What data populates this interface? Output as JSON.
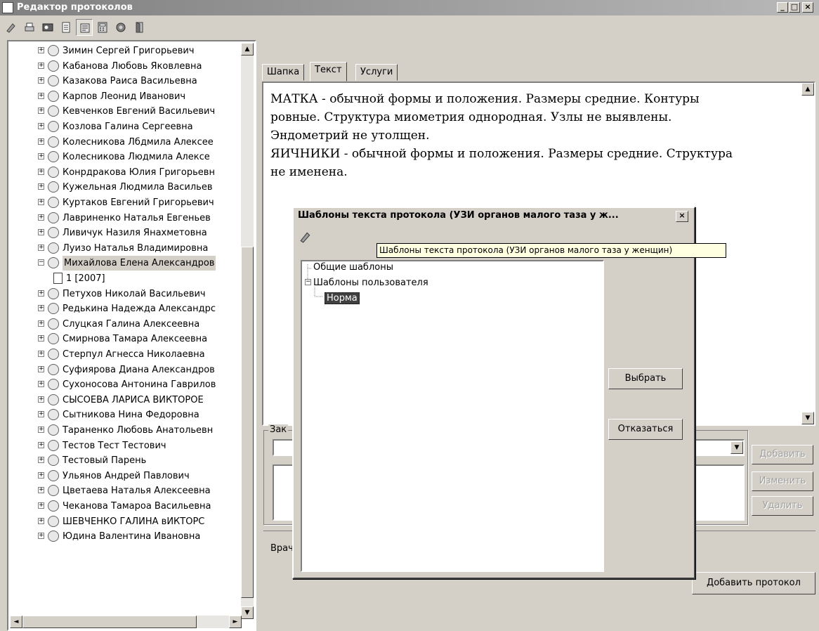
{
  "window": {
    "title": "Редактор протоколов",
    "min": "_",
    "max": "□",
    "close": "×"
  },
  "toolbar": {
    "icons": [
      "edit-icon",
      "print-icon",
      "patient-card-icon",
      "protocol-icon",
      "template-icon",
      "calculator-icon",
      "settings-icon",
      "exit-icon"
    ]
  },
  "patients": [
    "Зимин Сергей Григорьевич",
    "Кабанова Любовь Яковлевна",
    "Казакова Раиса Васильевна",
    "Карпов Леонид Иванович",
    "Кевченков Евгений Васильевич",
    "Козлова Галина Сергеевна",
    "Колесникова Лбдмила Алексее",
    "Колесникова Людмила Алексе",
    "Конрдракова Юлия Григорьевн",
    "Кужельная Людмила Васильев",
    "Куртаков Евгений Григорьевич",
    "Лавриненко Наталья Евгеньев",
    "Ливичук Назиля Янахметовна",
    "Луизо Наталья Владимировна",
    "Михайлова Елена Александров",
    "1 [2007]",
    "Петухов Николай Васильевич",
    "Редькина Надежда Александрс",
    "Слуцкая Галина Алексеевна",
    "Смирнова Тамара Алексеевна",
    "Стерпул Агнесса Николаевна",
    "Суфиярова Диана Александров",
    "Сухоносова Антонина Гаврилов",
    "СЫСОЕВА ЛАРИСА ВИКТОРОЕ",
    "Сытникова Нина Федоровна",
    "Тараненко Любовь Анатольевн",
    "Тестов Тест Тестович",
    "Тестовый Парень",
    "Ульянов Андрей Павлович",
    "Цветаева Наталья Алексеевна",
    "Чеканова Тамароа Васильевна",
    "ШЕВЧЕНКО ГАЛИНА вИКТОРС",
    "Юдина Валентина Ивановна"
  ],
  "tabs": [
    "Шапка",
    "Текст",
    "Услуги"
  ],
  "protocol_text": [
    "МАТКА - обычной формы и положения. Размеры средние. Контуры",
    "ровные. Структура миометрия однородная. Узлы не выявлены.",
    "Эндометрий не утолщен.",
    "ЯИЧНИКИ - обычной формы и положения. Размеры средние. Структура",
    "не именена."
  ],
  "conclusion": {
    "label_partial": "Зак",
    "add": "Добавить",
    "edit": "Изменить",
    "delete": "Удалить"
  },
  "doctor_label_partial": "Врач",
  "add_protocol": "Добавить протокол",
  "dialog": {
    "title": "Шаблоны текста протокола (УЗИ органов малого таза у ж...",
    "close": "×",
    "tooltip": "Шаблоны текста протокола (УЗИ органов малого таза у женщин)",
    "tree": [
      "Общие шаблоны",
      "Шаблоны пользователя",
      "Норма"
    ],
    "select_button": "Выбрать",
    "cancel_button": "Отказаться"
  },
  "scroll_arrows": {
    "up": "▲",
    "down": "▼",
    "left": "◄",
    "right": "►"
  }
}
